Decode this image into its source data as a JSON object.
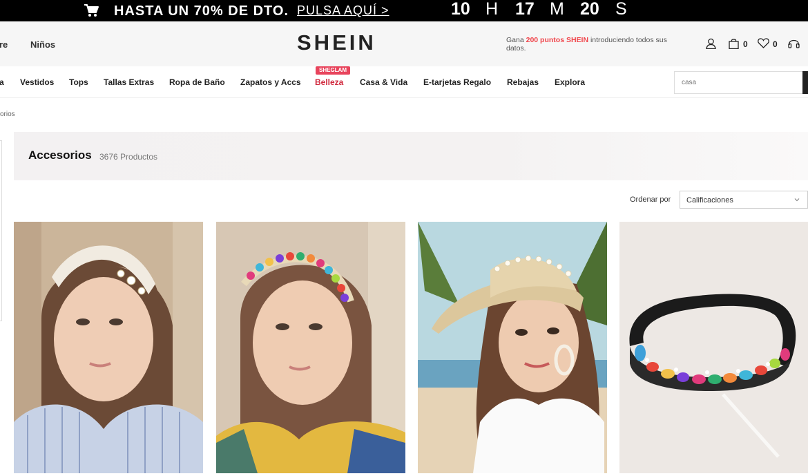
{
  "promo": {
    "text": "HASTA UN 70% DE DTO.",
    "link": "PULSA AQUÍ >",
    "countdown": [
      {
        "value": "10",
        "unit": "H"
      },
      {
        "value": "17",
        "unit": "M"
      },
      {
        "value": "20",
        "unit": "S"
      }
    ]
  },
  "header": {
    "left_categories": [
      "re",
      "Niños"
    ],
    "logo": "SHEIN",
    "points": {
      "pre": "Gana ",
      "highlight": "200 puntos SHEIN",
      "post": " introduciendo todos sus datos."
    },
    "cart_count": "0",
    "wishlist_count": "0"
  },
  "nav": {
    "items": [
      "a",
      "Vestidos",
      "Tops",
      "Tallas Extras",
      "Ropa de Baño",
      "Zapatos y Accs",
      "Belleza",
      "Casa & Vida",
      "E-tarjetas Regalo",
      "Rebajas",
      "Explora"
    ],
    "badge": "SHEGLAM",
    "search_placeholder": "casa"
  },
  "breadcrumb": "orios",
  "category": {
    "title": "Accesorios",
    "count": "3676 Productos"
  },
  "sort": {
    "label": "Ordenar por",
    "selected": "Calificaciones"
  },
  "colors": {
    "promo_bg": "#000000",
    "accent_red": "#f0444a",
    "badge_pink": "#e8445c",
    "header_bg": "#f6f6f6"
  },
  "products": [
    {
      "desc": "white knotted headband"
    },
    {
      "desc": "rhinestone jeweled headband"
    },
    {
      "desc": "pearl straw sun visor"
    },
    {
      "desc": "black velvet jeweled headband"
    }
  ]
}
